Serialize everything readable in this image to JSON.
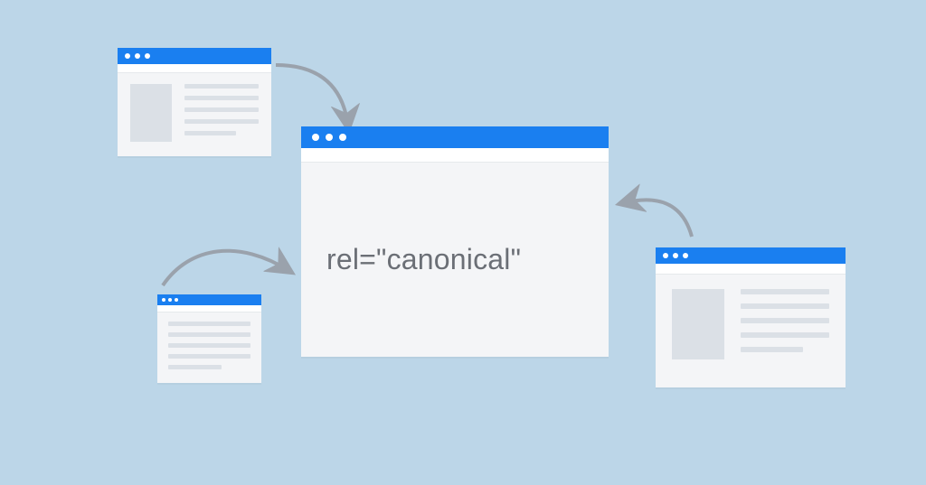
{
  "diagram": {
    "center_label": "rel=\"canonical\""
  },
  "colors": {
    "background": "#bcd6e8",
    "accent": "#1a7ff0",
    "window_body": "#f4f5f7",
    "toolbar": "#ffffff",
    "placeholder": "#dbe0e6",
    "arrow": "#9aa2ac",
    "text": "#6b6f76"
  }
}
